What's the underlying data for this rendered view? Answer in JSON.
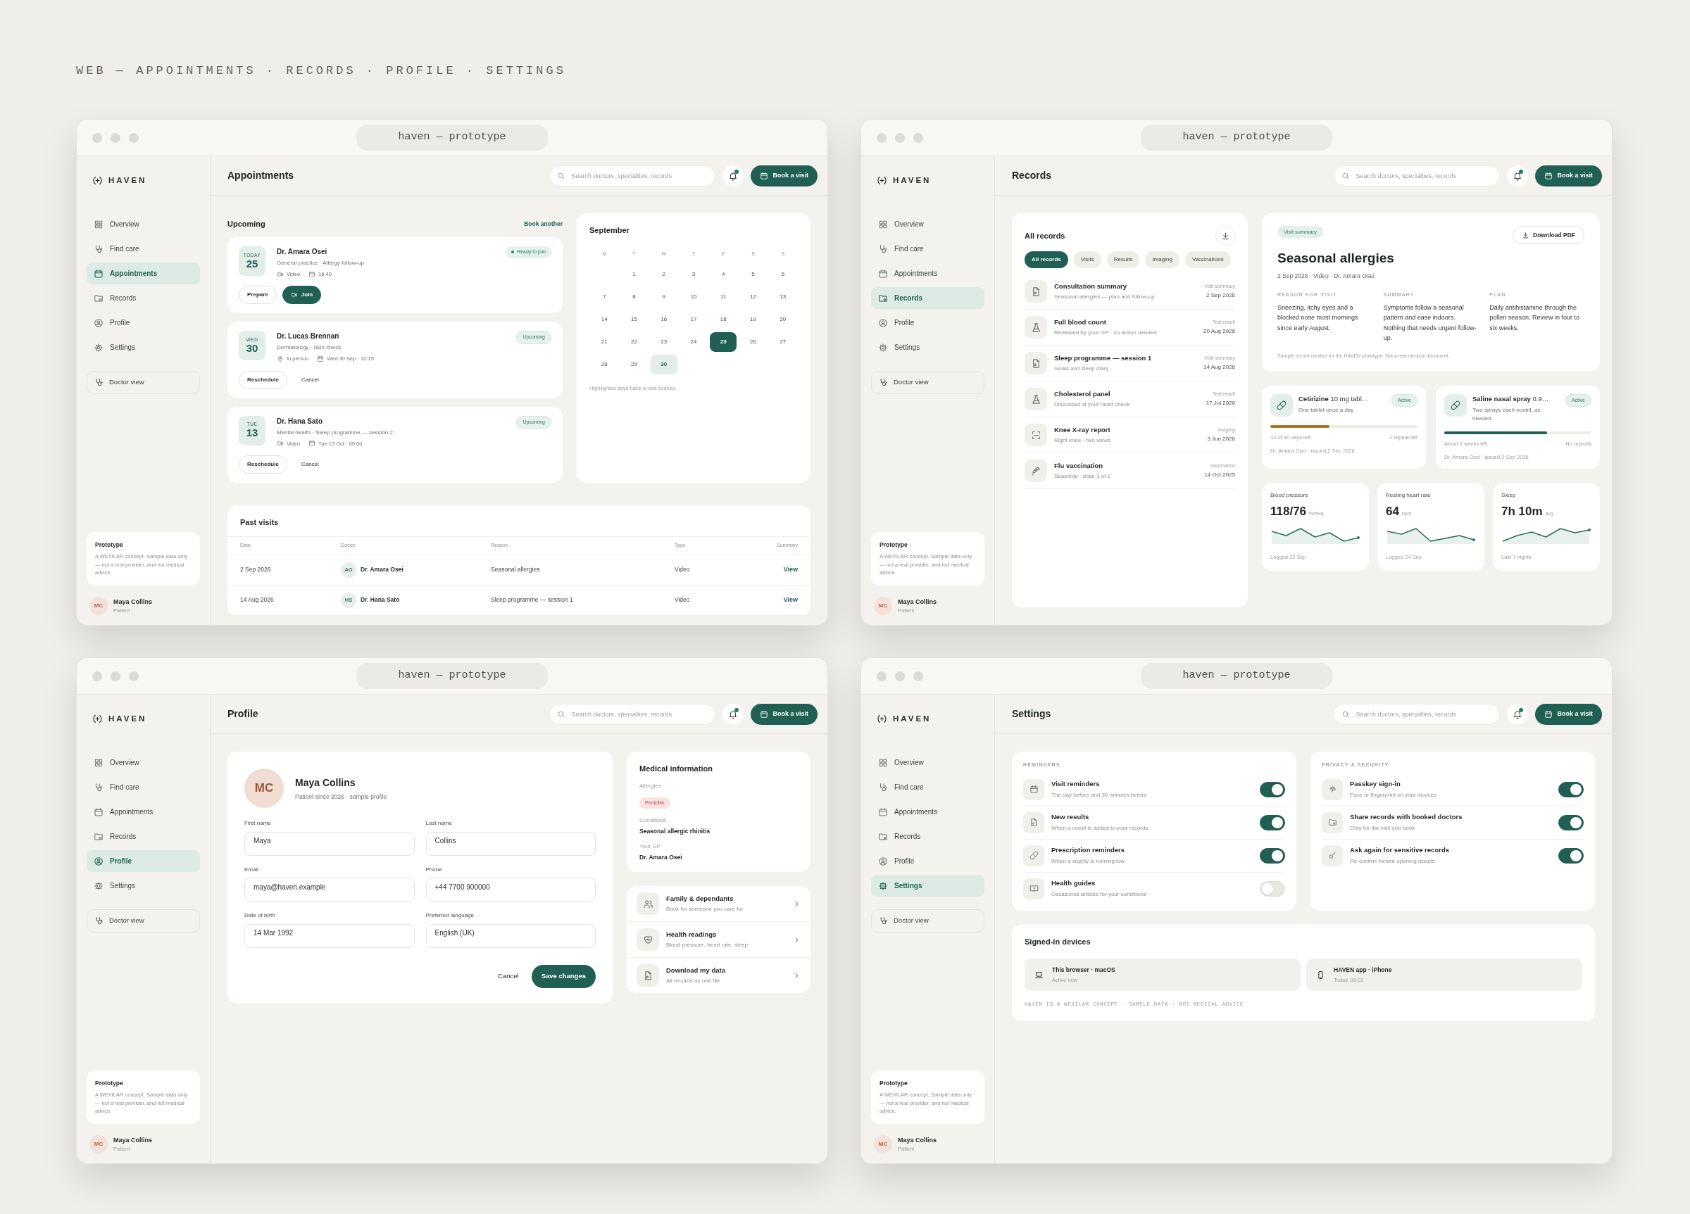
{
  "heading": "WEB — APPOINTMENTS · RECORDS · PROFILE · SETTINGS",
  "windows": [
    {
      "kind": "appointments",
      "title": "haven — prototype",
      "sidebar": {
        "brand": "HAVEN",
        "nav": [
          {
            "label": "Overview",
            "selected": false
          },
          {
            "label": "Find care",
            "selected": false
          },
          {
            "label": "Appointments",
            "selected": true
          },
          {
            "label": "Records",
            "selected": false
          },
          {
            "label": "Profile",
            "selected": false
          },
          {
            "label": "Settings",
            "selected": false
          }
        ],
        "doctor_view": "Doctor view",
        "note": {
          "title": "Prototype",
          "text": "A WEXILAR concept. Sample data only — not a real provider, and not medical advice."
        },
        "user": {
          "initials": "MC",
          "name": "Maya Collins",
          "role": "Patient"
        }
      },
      "topbar": {
        "title": "Appointments",
        "search_placeholder": "Search doctors, specialties, records",
        "book_button": "Book a visit"
      },
      "upcoming": {
        "title": "Upcoming",
        "link": "Book another",
        "items": [
          {
            "day": "TODAY",
            "date": "25",
            "doctor": "Dr. Amara Osei",
            "detail": "General practice · Allergy follow-up",
            "mode": {
              "kind": "video",
              "label": "Video"
            },
            "time": "16:40",
            "status": {
              "kind": "ready",
              "label": "Ready to join"
            },
            "actions": [
              {
                "label": "Prepare",
                "kind": "outline"
              },
              {
                "label": "Join",
                "kind": "primary"
              }
            ]
          },
          {
            "day": "WED",
            "date": "30",
            "doctor": "Dr. Lucas Brennan",
            "detail": "Dermatology · Skin check",
            "mode": {
              "kind": "in_person",
              "label": "In person"
            },
            "time": "Wed 30 Sep · 10:15",
            "status": {
              "kind": "upcoming",
              "label": "Upcoming"
            },
            "actions": [
              {
                "label": "Reschedule",
                "kind": "outline"
              },
              {
                "label": "Cancel",
                "kind": "text"
              }
            ]
          },
          {
            "day": "TUE",
            "date": "13",
            "doctor": "Dr. Hana Sato",
            "detail": "Mental health · Sleep programme — session 2",
            "mode": {
              "kind": "video",
              "label": "Video"
            },
            "time": "Tue 13 Oct · 09:00",
            "status": {
              "kind": "upcoming",
              "label": "Upcoming"
            },
            "actions": [
              {
                "label": "Reschedule",
                "kind": "outline"
              },
              {
                "label": "Cancel",
                "kind": "text"
              }
            ]
          }
        ]
      },
      "calendar": {
        "month": "September",
        "weekdays": [
          "M",
          "T",
          "W",
          "T",
          "F",
          "S",
          "S"
        ],
        "weeks": [
          [
            {
              "day": "1",
              "booked": false,
              "today": false
            },
            {
              "day": "2",
              "booked": false,
              "today": false
            },
            {
              "day": "3",
              "booked": false,
              "today": false
            },
            {
              "day": "4",
              "booked": false,
              "today": false
            },
            {
              "day": "5",
              "booked": false,
              "today": false
            },
            {
              "day": "6",
              "booked": false,
              "today": false
            }
          ],
          [
            {
              "day": "7",
              "booked": false,
              "today": false
            },
            {
              "day": "8",
              "booked": false,
              "today": false
            },
            {
              "day": "9",
              "booked": false,
              "today": false
            },
            {
              "day": "10",
              "booked": false,
              "today": false
            },
            {
              "day": "11",
              "booked": false,
              "today": false
            },
            {
              "day": "12",
              "booked": false,
              "today": false
            },
            {
              "day": "13",
              "booked": false,
              "today": false
            }
          ],
          [
            {
              "day": "14",
              "booked": false,
              "today": false
            },
            {
              "day": "15",
              "booked": false,
              "today": false
            },
            {
              "day": "16",
              "booked": false,
              "today": false
            },
            {
              "day": "17",
              "booked": false,
              "today": false
            },
            {
              "day": "18",
              "booked": false,
              "today": false
            },
            {
              "day": "19",
              "booked": false,
              "today": false
            },
            {
              "day": "20",
              "booked": false,
              "today": false
            }
          ],
          [
            {
              "day": "21",
              "booked": false,
              "today": false
            },
            {
              "day": "22",
              "booked": false,
              "today": false
            },
            {
              "day": "23",
              "booked": false,
              "today": false
            },
            {
              "day": "24",
              "booked": false,
              "today": false
            },
            {
              "day": "25",
              "booked": true,
              "today": true
            },
            {
              "day": "26",
              "booked": false,
              "today": false
            },
            {
              "day": "27",
              "booked": false,
              "today": false
            }
          ],
          [
            {
              "day": "28",
              "booked": false,
              "today": false
            },
            {
              "day": "29",
              "booked": false,
              "today": false
            },
            {
              "day": "30",
              "booked": true,
              "today": false
            }
          ]
        ],
        "note": "Highlighted days have a visit booked."
      },
      "past_visits": {
        "title": "Past visits",
        "columns": [
          "Date",
          "Doctor",
          "Reason",
          "Type",
          "Summary"
        ],
        "rows": [
          {
            "date": "2 Sep 2026",
            "initials": "AO",
            "doctor": "Dr. Amara Osei",
            "reason": "Seasonal allergies",
            "type": "Video",
            "link": "View"
          },
          {
            "date": "14 Aug 2026",
            "initials": "HS",
            "doctor": "Dr. Hana Sato",
            "reason": "Sleep programme — session 1",
            "type": "Video",
            "link": "View"
          }
        ]
      }
    },
    {
      "kind": "records",
      "title": "haven — prototype",
      "sidebar": {
        "brand": "HAVEN",
        "nav": [
          {
            "label": "Overview",
            "selected": false
          },
          {
            "label": "Find care",
            "selected": false
          },
          {
            "label": "Appointments",
            "selected": false
          },
          {
            "label": "Records",
            "selected": true
          },
          {
            "label": "Profile",
            "selected": false
          },
          {
            "label": "Settings",
            "selected": false
          }
        ],
        "doctor_view": "Doctor view",
        "note": {
          "title": "Prototype",
          "text": "A WEXILAR concept. Sample data only — not a real provider, and not medical advice."
        },
        "user": {
          "initials": "MC",
          "name": "Maya Collins",
          "role": "Patient"
        }
      },
      "topbar": {
        "title": "Records",
        "search_placeholder": "Search doctors, specialties, records",
        "book_button": "Book a visit"
      },
      "records": {
        "title": "All records",
        "filters": [
          {
            "label": "All records",
            "selected": true
          },
          {
            "label": "Visits",
            "selected": false
          },
          {
            "label": "Results",
            "selected": false
          },
          {
            "label": "Imaging",
            "selected": false
          },
          {
            "label": "Vaccinations",
            "selected": false
          }
        ],
        "items": [
          {
            "kind": "visit",
            "title": "Consultation summary",
            "subtitle": "Seasonal allergies — plan and follow-up",
            "type": "Visit summary",
            "date": "2 Sep 2026"
          },
          {
            "kind": "result",
            "title": "Full blood count",
            "subtitle": "Reviewed by your GP · no action needed",
            "type": "Test result",
            "date": "20 Aug 2026"
          },
          {
            "kind": "visit",
            "title": "Sleep programme — session 1",
            "subtitle": "Goals and sleep diary",
            "type": "Visit summary",
            "date": "14 Aug 2026"
          },
          {
            "kind": "result",
            "title": "Cholesterol panel",
            "subtitle": "Discussed at your heart check",
            "type": "Test result",
            "date": "17 Jul 2026"
          },
          {
            "kind": "imaging",
            "title": "Knee X-ray report",
            "subtitle": "Right knee · two views",
            "type": "Imaging",
            "date": "3 Jun 2026"
          },
          {
            "kind": "vaccination",
            "title": "Flu vaccination",
            "subtitle": "Seasonal · dose 1 of 1",
            "type": "Vaccination",
            "date": "14 Oct 2025"
          }
        ]
      },
      "detail": {
        "tag": "Visit summary",
        "download": "Download PDF",
        "title": "Seasonal allergies",
        "meta": "2 Sep 2026 · Video · Dr. Amara Osei",
        "sections": [
          {
            "heading": "REASON FOR VISIT",
            "text": "Sneezing, itchy eyes and a blocked nose most mornings since early August."
          },
          {
            "heading": "SUMMARY",
            "text": "Symptoms follow a seasonal pattern and ease indoors. Nothing that needs urgent follow-up."
          },
          {
            "heading": "PLAN",
            "text": "Daily antihistamine through the pollen season. Review in four to six weeks."
          }
        ],
        "footnote": "Sample record created for the HAVEN prototype. Not a real medical document."
      },
      "medications": [
        {
          "name": "**Cetirizine** 10 mg tabl…",
          "status": "Active",
          "instructions": "One tablet once a day",
          "level": 0.4,
          "color": "#a8781f",
          "remaining": "12 of 30 days left",
          "repeats": "1 repeat left",
          "issued": "Dr. Amara Osei · issued 2 Sep 2026"
        },
        {
          "name": "**Saline nasal spray** 0.9…",
          "status": "Active",
          "instructions": "Two sprays each nostril, as needed",
          "level": 0.7,
          "color": "#1f5f54",
          "remaining": "About 3 weeks left",
          "repeats": "No repeats",
          "issued": "Dr. Amara Osei · issued 2 Sep 2026"
        }
      ],
      "vitals": [
        {
          "label": "Blood pressure",
          "value": "118/76",
          "unit": "mmHg",
          "note": "Logged 22 Sep"
        },
        {
          "label": "Resting heart rate",
          "value": "64",
          "unit": "bpm",
          "note": "Logged 24 Sep"
        },
        {
          "label": "Sleep",
          "value": "7h 10m",
          "unit": "avg",
          "note": "Last 7 nights"
        }
      ]
    },
    {
      "kind": "profile",
      "title": "haven — prototype",
      "sidebar": {
        "brand": "HAVEN",
        "nav": [
          {
            "label": "Overview",
            "selected": false
          },
          {
            "label": "Find care",
            "selected": false
          },
          {
            "label": "Appointments",
            "selected": false
          },
          {
            "label": "Records",
            "selected": false
          },
          {
            "label": "Profile",
            "selected": true
          },
          {
            "label": "Settings",
            "selected": false
          }
        ],
        "doctor_view": "Doctor view",
        "note": {
          "title": "Prototype",
          "text": "A WEXILAR concept. Sample data only — not a real provider, and not medical advice."
        },
        "user": {
          "initials": "MC",
          "name": "Maya Collins",
          "role": "Patient"
        }
      },
      "topbar": {
        "title": "Profile",
        "search_placeholder": "Search doctors, specialties, records",
        "book_button": "Book a visit"
      },
      "profile": {
        "initials": "MC",
        "name": "Maya Collins",
        "subtitle": "Patient since 2026 · sample profile",
        "fields": [
          {
            "label": "First name",
            "value": "Maya"
          },
          {
            "label": "Last name",
            "value": "Collins"
          },
          {
            "label": "Email",
            "value": "maya@haven.example"
          },
          {
            "label": "Phone",
            "value": "+44 7700 900000"
          },
          {
            "label": "Date of birth",
            "value": "14 Mar 1992"
          },
          {
            "label": "Preferred language",
            "value": "English (UK)"
          }
        ],
        "cancel": "Cancel",
        "save": "Save changes"
      },
      "medical": {
        "title": "Medical information",
        "items": [
          {
            "label": "Allergies",
            "value": "Penicillin",
            "kind": "tag"
          },
          {
            "label": "Conditions",
            "value": "Seasonal allergic rhinitis",
            "kind": "text"
          },
          {
            "label": "Your GP",
            "value": "Dr. Amara Osei",
            "kind": "text"
          }
        ]
      },
      "links": [
        {
          "title": "Family & dependants",
          "subtitle": "Book for someone you care for"
        },
        {
          "title": "Health readings",
          "subtitle": "Blood pressure, heart rate, sleep"
        },
        {
          "title": "Download my data",
          "subtitle": "All records as one file"
        }
      ]
    },
    {
      "kind": "settings",
      "title": "haven — prototype",
      "sidebar": {
        "brand": "HAVEN",
        "nav": [
          {
            "label": "Overview",
            "selected": false
          },
          {
            "label": "Find care",
            "selected": false
          },
          {
            "label": "Appointments",
            "selected": false
          },
          {
            "label": "Records",
            "selected": false
          },
          {
            "label": "Profile",
            "selected": false
          },
          {
            "label": "Settings",
            "selected": true
          }
        ],
        "doctor_view": "Doctor view",
        "note": {
          "title": "Prototype",
          "text": "A WEXILAR concept. Sample data only — not a real provider, and not medical advice."
        },
        "user": {
          "initials": "MC",
          "name": "Maya Collins",
          "role": "Patient"
        }
      },
      "topbar": {
        "title": "Settings",
        "search_placeholder": "Search doctors, specialties, records",
        "book_button": "Book a visit"
      },
      "groups": [
        {
          "heading": "REMINDERS",
          "items": [
            {
              "title": "Visit reminders",
              "subtitle": "The day before and 30 minutes before",
              "on": true
            },
            {
              "title": "New results",
              "subtitle": "When a result is added to your records",
              "on": true
            },
            {
              "title": "Prescription reminders",
              "subtitle": "When a supply is running low",
              "on": true
            },
            {
              "title": "Health guides",
              "subtitle": "Occasional articles for your conditions",
              "on": false
            }
          ]
        },
        {
          "heading": "PRIVACY & SECURITY",
          "items": [
            {
              "title": "Passkey sign-in",
              "subtitle": "Face or fingerprint on your devices",
              "on": true
            },
            {
              "title": "Share records with booked doctors",
              "subtitle": "Only for the visit you book",
              "on": true
            },
            {
              "title": "Ask again for sensitive records",
              "subtitle": "Re-confirm before opening results",
              "on": true
            }
          ]
        }
      ],
      "devices": {
        "title": "Signed-in devices",
        "items": [
          {
            "kind": "laptop",
            "name": "This browser · macOS",
            "status": "Active now"
          },
          {
            "kind": "phone",
            "name": "HAVEN app · iPhone",
            "status": "Today, 08:02"
          }
        ],
        "footnote": "HAVEN IS A WEXILAR CONCEPT · SAMPLE DATA · NOT MEDICAL ADVICE"
      }
    }
  ]
}
